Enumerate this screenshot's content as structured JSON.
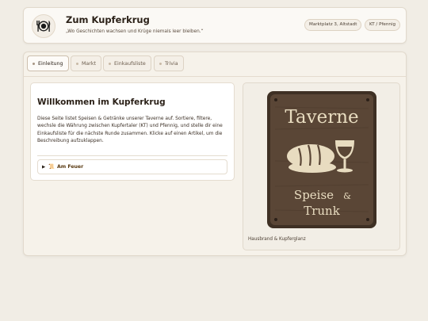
{
  "header": {
    "title": "Zum Kupferkrug",
    "subtitle": "„Wo Geschichten wachsen und Krüge niemals leer bleiben.“",
    "chips": {
      "location": "Marktplatz 3, Altstadt",
      "currency": "KT / Pfennig"
    }
  },
  "tabs": [
    {
      "label": "Einleitung",
      "active": true
    },
    {
      "label": "Markt",
      "active": false
    },
    {
      "label": "Einkaufsliste",
      "active": false
    },
    {
      "label": "Trivia",
      "active": false
    }
  ],
  "intro": {
    "heading": "Willkommen im Kupferkrug",
    "description": "Diese Seite listet Speisen & Getränke unserer Taverne auf. Sortiere, filtere, wechsle die Währung zwischen Kupfertaler (KT) und Pfennig, und stelle dir eine Einkaufsliste für die nächste Runde zusammen. Klicke auf einen Artikel, um die Beschreibung aufzuklappen.",
    "details": {
      "arrow": "▶",
      "icon": "scroll-icon",
      "label": "Am Feuer"
    }
  },
  "sign": {
    "line1": "Taverne",
    "line2": "Speise",
    "amp": "&",
    "line3": "Trunk",
    "caption": "Hausbrand & Kupferglanz"
  },
  "colors": {
    "background": "#f1ede5",
    "sign_wood": "#5a4636",
    "sign_text": "#e8dcc0"
  }
}
